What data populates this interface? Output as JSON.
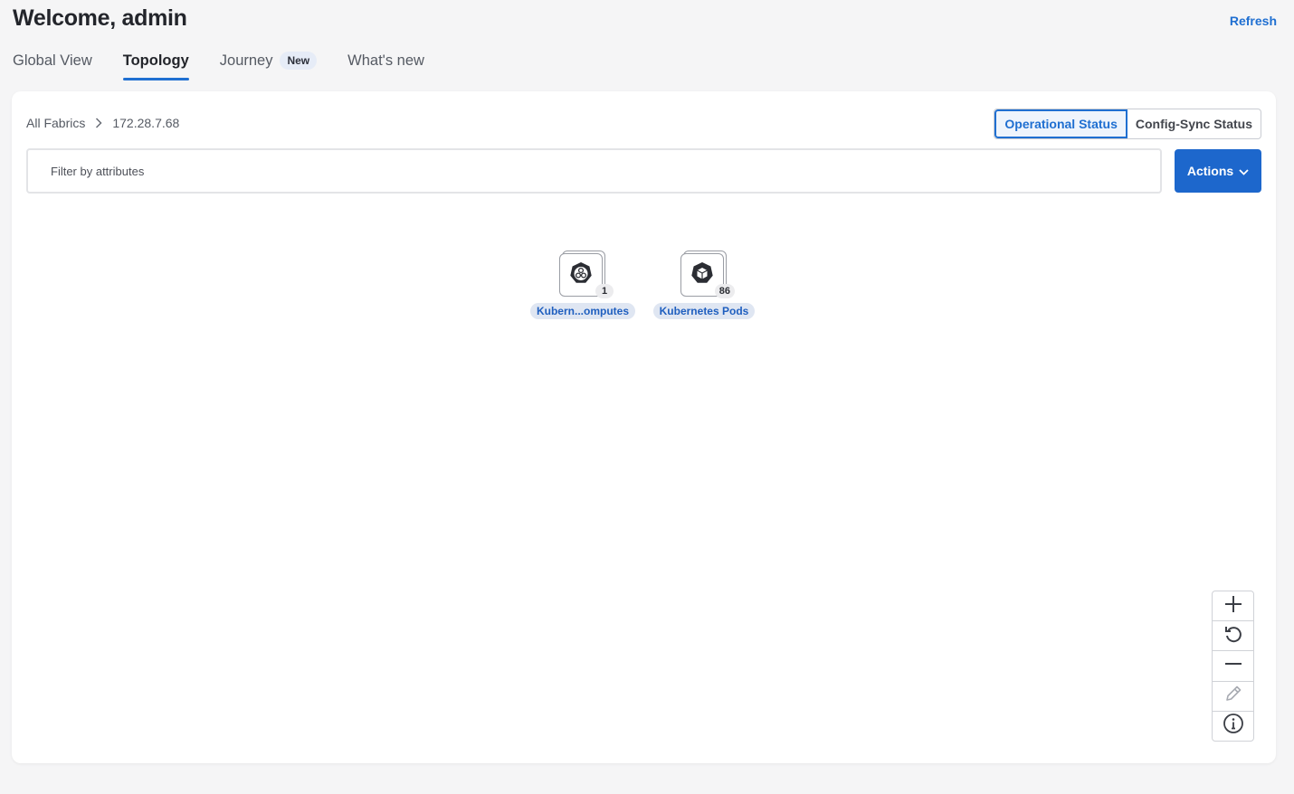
{
  "header": {
    "title": "Welcome, admin",
    "refresh_label": "Refresh"
  },
  "tabs": [
    {
      "label": "Global View",
      "active": false
    },
    {
      "label": "Topology",
      "active": true
    },
    {
      "label": "Journey",
      "badge": "New",
      "active": false
    },
    {
      "label": "What's new",
      "active": false
    }
  ],
  "breadcrumb": {
    "root": "All Fabrics",
    "current": "172.28.7.68"
  },
  "status_toggle": {
    "options": [
      "Operational Status",
      "Config-Sync Status"
    ],
    "selected": "Operational Status"
  },
  "filter": {
    "placeholder": "Filter by attributes",
    "value": ""
  },
  "actions": {
    "label": "Actions"
  },
  "topology": {
    "nodes": [
      {
        "label": "Kubern...omputes",
        "count": "1",
        "icon": "kubernetes-compute-icon"
      },
      {
        "label": "Kubernetes Pods",
        "count": "86",
        "icon": "kubernetes-pod-icon"
      }
    ]
  },
  "zoom_controls": [
    "zoom-in-icon",
    "reset-view-icon",
    "zoom-out-icon",
    "edit-icon",
    "info-icon"
  ],
  "colors": {
    "accent": "#1f6fd1",
    "primary_button": "#1d67cc",
    "node_label_bg": "#dfe6f2",
    "page_bg": "#f5f5f6"
  }
}
